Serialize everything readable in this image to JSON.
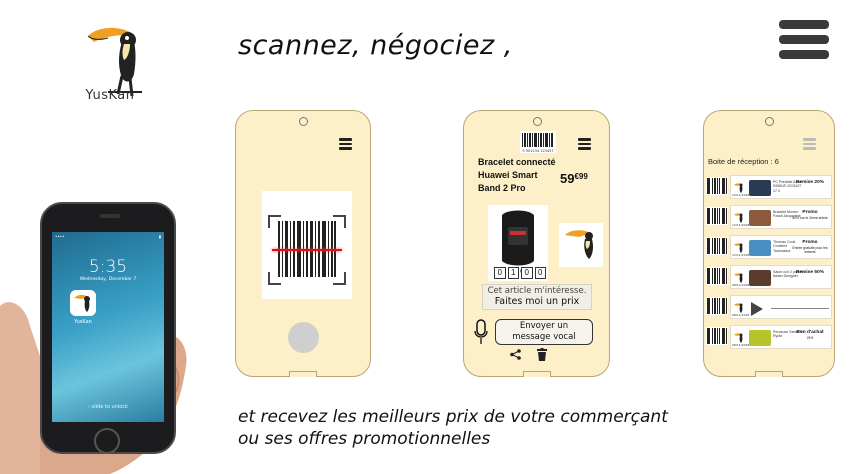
{
  "brand": {
    "name": "YusKan"
  },
  "headline": "scannez,  négociez ,",
  "tagline": [
    "et recevez les meilleurs prix  de votre commerçant",
    "ou ses offres promotionnelles"
  ],
  "phone": {
    "time": "5:35",
    "date": "Wednesday, December 7",
    "app_label": "YusKan",
    "unlock_text": "› slide to unlock"
  },
  "product_screen": {
    "barcode_number": "5 901234 123457",
    "product_name": "Bracelet connecté Huawei Smart Band 2 Pro",
    "price_main": "59",
    "price_cents": "€99",
    "digits": [
      "0",
      "1",
      "0",
      "0"
    ],
    "interest_line1": "Cet article m'intéresse.",
    "interest_line2": "Faites moi un prix",
    "voice_line1": "Envoyer un",
    "voice_line2": "message vocal"
  },
  "inbox_screen": {
    "title": "Boite de réception : 6",
    "rows": [
      {
        "date": "12/11/2018",
        "desc": "PC Portable Asus K555UF-GG344T 17.3",
        "offer": "Remise 20%",
        "offer_small": "",
        "pic_color": "#2b3a55"
      },
      {
        "date": "12/11/2018",
        "desc": "Bracelet Montre Fossil Jacqueline",
        "offer": "Promo",
        "offer_small": "50% sur le 2ème article",
        "pic_color": "#8b5a3c"
      },
      {
        "date": "12/11/2018",
        "desc": "Thomas Cook Croisière Toamasina",
        "offer": "Promo",
        "offer_small": "Entrée gratuite pour les enfants",
        "pic_color": "#4a8fc2"
      },
      {
        "date": "08/11/2018",
        "desc": "Salon cuir 2 places Italian Designer",
        "offer": "Remise 50%",
        "offer_small": "",
        "pic_color": "#5a3a2a"
      },
      {
        "date": "08/11/2018",
        "desc": "",
        "offer": "",
        "offer_small": "",
        "pic_color": ""
      },
      {
        "date": "08/11/2018",
        "desc": "Perceuse Sans Fil Ryobi",
        "offer": "Bon d'achat",
        "offer_small": "25 €",
        "pic_color": "#b8c22a"
      }
    ]
  },
  "colors": {
    "mockup_bg": "#fdf0c9",
    "laser": "#e01010"
  }
}
